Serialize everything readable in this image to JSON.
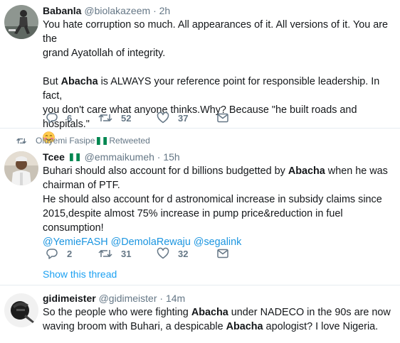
{
  "tweets": [
    {
      "name": "Babanla",
      "handle": "@biolakazeem",
      "separator": "·",
      "time": "2h",
      "line1": "You hate corruption so much. All appearances of it. All versions of it. You are the",
      "line2": "grand Ayatollah of integrity.",
      "p2_pre": "But ",
      "p2_bold": "Abacha",
      "p2_post": " is ALWAYS your reference point for responsible leadership. In fact,",
      "line4": "you don't care what anyone thinks.Why? Because \"he built roads and hospitals.\"",
      "replies": "6",
      "retweets": "52",
      "likes": "37"
    },
    {
      "retweeted_by": "Oluyemi Fasipe",
      "retweeted_label": "Retweeted",
      "name": "Tcee",
      "handle": "@emmaikumeh",
      "separator": "·",
      "time": "15h",
      "l1_pre": "Buhari should also account for d billions budgetted by ",
      "l1_bold": "Abacha",
      "l1_post": " when he was",
      "line2": "chairman of PTF.",
      "line3": "He should also account for d astronomical increase in subsidy claims since",
      "line4": "2015,despite almost 75% increase in pump price&reduction in fuel consumption!",
      "mentions": [
        "@YemieFASH",
        "@DemolaRewaju",
        "@segalink"
      ],
      "replies": "2",
      "retweets": "31",
      "likes": "32",
      "show_thread": "Show this thread"
    },
    {
      "name": "gidimeister",
      "handle": "@gidimeister",
      "separator": "·",
      "time": "14m",
      "l1_pre": "So the people who were fighting ",
      "l1_bold": "Abacha",
      "l1_post": " under NADECO in the 90s are now",
      "l2_pre": "waving broom with Buhari, a despicable ",
      "l2_bold": "Abacha",
      "l2_post": " apologist? I love Nigeria."
    }
  ],
  "colors": {
    "text": "#14171a",
    "muted": "#657786",
    "link": "#1b95e0",
    "nigeria_green": "#008751"
  }
}
